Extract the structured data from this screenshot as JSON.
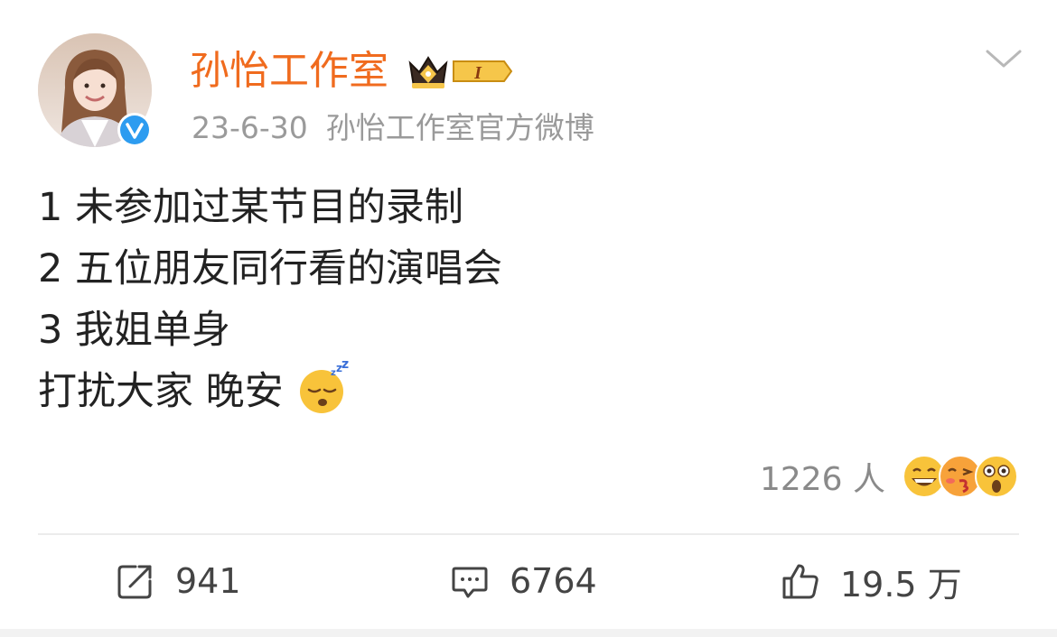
{
  "post": {
    "author": "孙怡工作室",
    "date": "23-6-30",
    "source": "孙怡工作室官方微博",
    "content_lines": [
      "1 未参加过某节目的录制",
      "2 五位朋友同行看的演唱会",
      "3 我姐单身",
      "打扰大家 晚安"
    ],
    "vip_level": "I"
  },
  "reactions": {
    "count_label": "1226 人",
    "faces": [
      "grin-face-icon",
      "kiss-face-icon",
      "shocked-face-icon"
    ]
  },
  "actions": {
    "repost": "941",
    "comment": "6764",
    "like": "19.5 万"
  },
  "colors": {
    "username": "#f06b1e",
    "verified": "#2d9cf0",
    "meta": "#9a9a9a",
    "text": "#222222"
  }
}
